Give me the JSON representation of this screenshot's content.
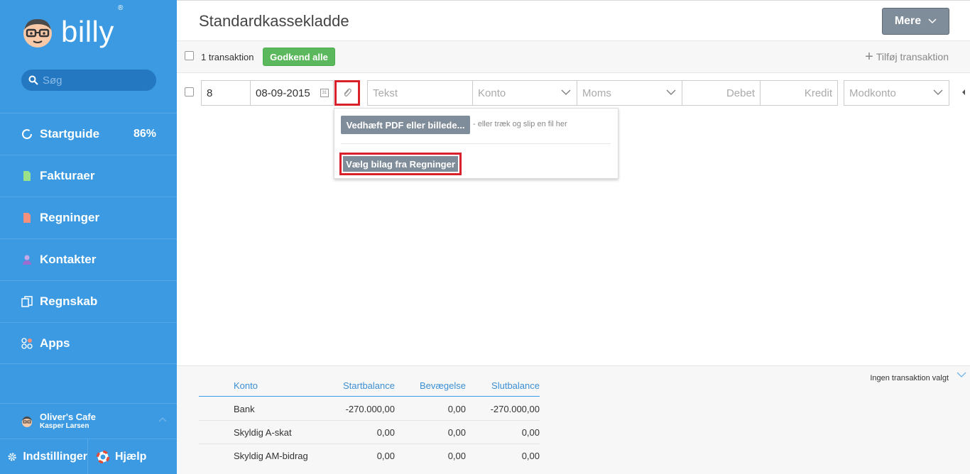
{
  "brand": {
    "name": "billy",
    "reg": "®"
  },
  "search": {
    "placeholder": "Søg"
  },
  "sidebar": {
    "items": [
      {
        "label": "Startguide",
        "badge": "86%"
      },
      {
        "label": "Fakturaer"
      },
      {
        "label": "Regninger"
      },
      {
        "label": "Kontakter"
      },
      {
        "label": "Regnskab"
      },
      {
        "label": "Apps"
      }
    ],
    "org": {
      "name": "Oliver's Cafe",
      "user": "Kasper Larsen"
    },
    "footer": {
      "settings": "Indstillinger",
      "help": "Hjælp"
    }
  },
  "header": {
    "title": "Standardkassekladde",
    "more_label": "Mere"
  },
  "actions": {
    "count": "1 transaktion",
    "approve_all": "Godkend alle",
    "add": "Tilføj transaktion"
  },
  "row": {
    "number": "8",
    "date": "08-09-2015",
    "cal_label": "31",
    "text_placeholder": "Tekst",
    "account_placeholder": "Konto",
    "vat_placeholder": "Moms",
    "debit_placeholder": "Debet",
    "credit_placeholder": "Kredit",
    "contra_placeholder": "Modkonto"
  },
  "popup": {
    "attach_label": "Vedhæft PDF eller billede...",
    "hint": "- eller træk og slip en fil her",
    "choose_label": "Vælg bilag fra Regninger"
  },
  "balance": {
    "headers": [
      "Konto",
      "Startbalance",
      "Bevægelse",
      "Slutbalance"
    ],
    "rows": [
      {
        "account": "Bank",
        "start": "-270.000,00",
        "move": "0,00",
        "end": "-270.000,00"
      },
      {
        "account": "Skyldig A-skat",
        "start": "0,00",
        "move": "0,00",
        "end": "0,00"
      },
      {
        "account": "Skyldig AM-bidrag",
        "start": "0,00",
        "move": "0,00",
        "end": "0,00"
      }
    ],
    "no_selection": "Ingen transaktion valgt"
  },
  "colors": {
    "sidebar": "#3b9ae1",
    "accent_green": "#5cb85c",
    "highlight_red": "#d9212c",
    "button_gray": "#7f8c99"
  }
}
